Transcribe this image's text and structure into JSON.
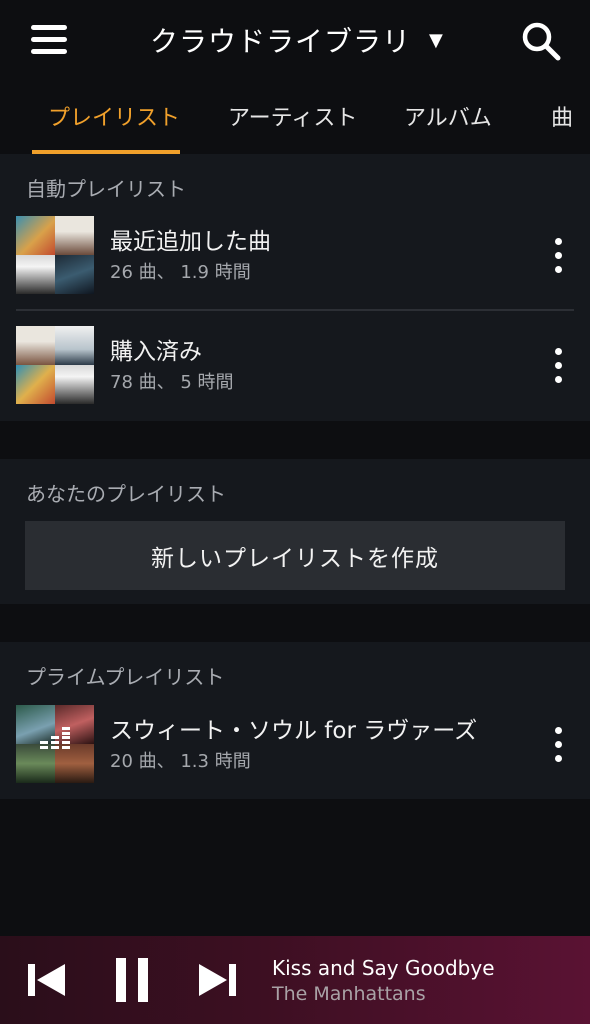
{
  "header": {
    "title": "クラウドライブラリ",
    "dropdown_icon": "triangle-down",
    "menu_icon": "hamburger-menu",
    "search_icon": "magnifier"
  },
  "tabs": [
    {
      "label": "プレイリスト",
      "active": true
    },
    {
      "label": "アーティスト",
      "active": false
    },
    {
      "label": "アルバム",
      "active": false
    },
    {
      "label": "曲",
      "active": false
    }
  ],
  "auto_playlists": {
    "label": "自動プレイリスト",
    "items": [
      {
        "title": "最近追加した曲",
        "subtitle": "26 曲、 1.9 時間"
      },
      {
        "title": "購入済み",
        "subtitle": "78 曲、 5 時間"
      }
    ]
  },
  "your_playlists": {
    "label": "あなたのプレイリスト",
    "create_label": "新しいプレイリストを作成"
  },
  "prime_playlists": {
    "label": "プライムプレイリスト",
    "items": [
      {
        "title": "スウィート・ソウル for ラヴァーズ",
        "subtitle": "20 曲、 1.3 時間"
      }
    ]
  },
  "player": {
    "title": "Kiss and Say Goodbye",
    "artist": "The Manhattans",
    "controls": [
      "previous-icon",
      "pause-icon",
      "next-icon"
    ]
  },
  "colors": {
    "accent": "#f0a02b",
    "background": "#0d0e11",
    "section": "#15181d",
    "player_start": "#2a0e1a",
    "player_end": "#5a1233"
  }
}
